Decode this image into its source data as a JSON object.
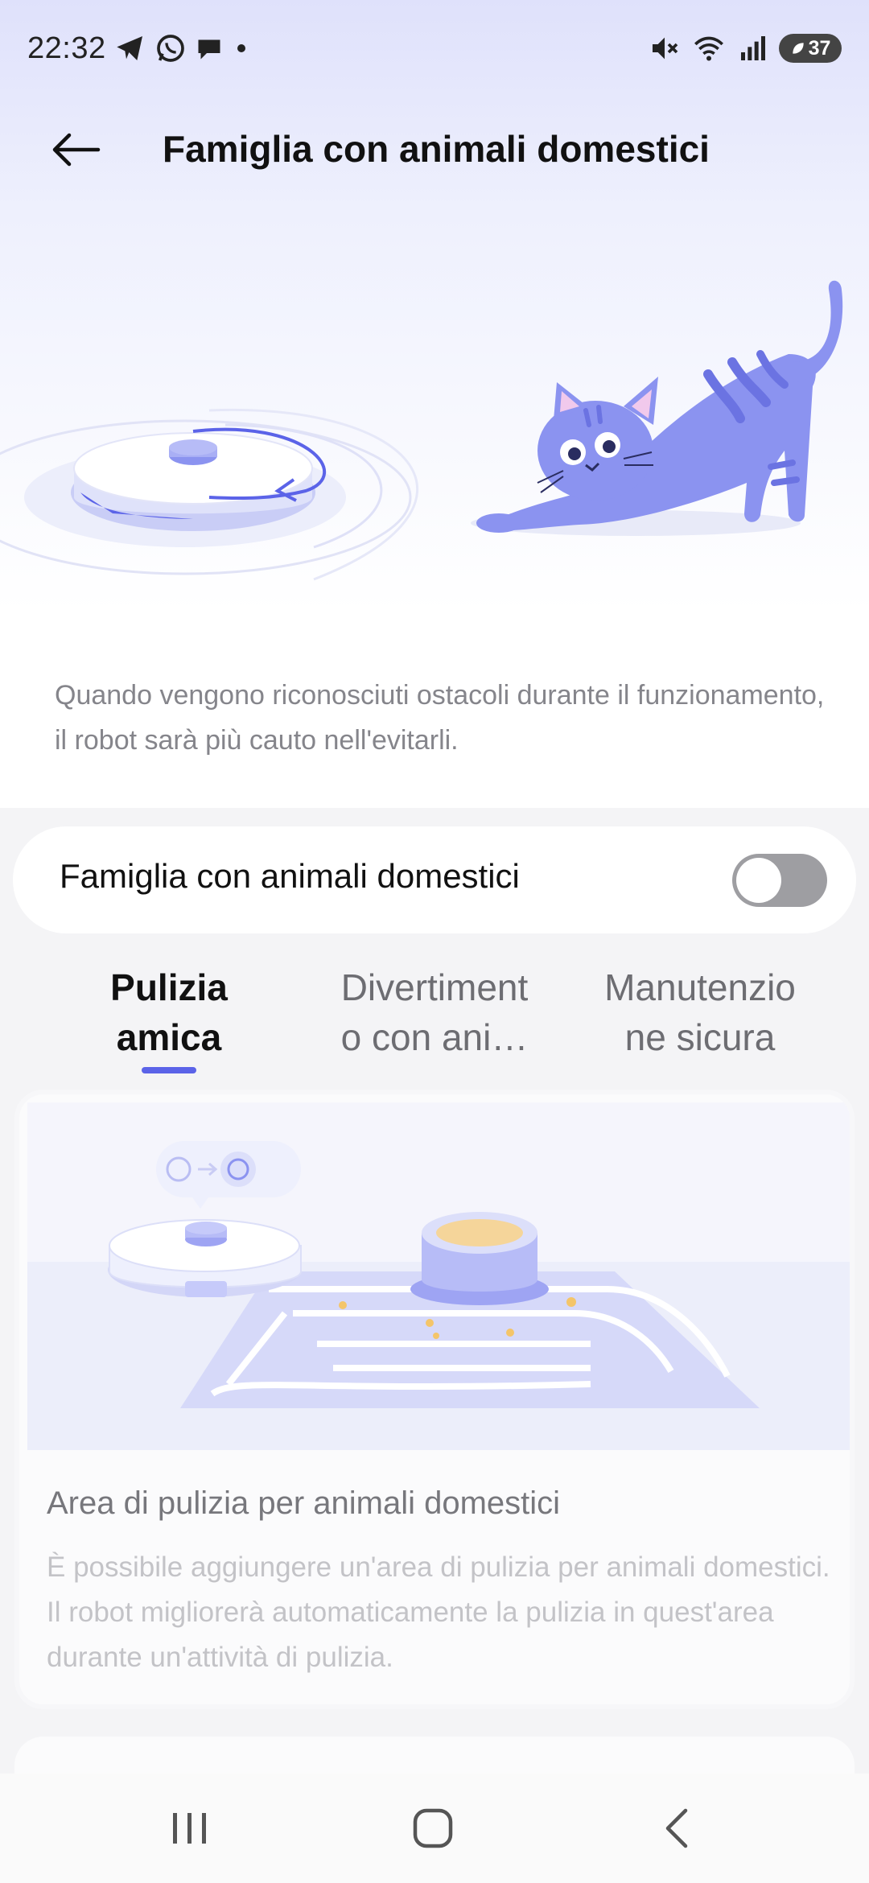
{
  "status_bar": {
    "time": "22:32",
    "battery_level": "37",
    "notification_icons": [
      "telegram-icon",
      "whatsapp-icon",
      "chat-bubble-icon",
      "dot-icon"
    ],
    "system_icons": [
      "mute-icon",
      "wifi-icon",
      "signal-icon"
    ]
  },
  "header": {
    "title": "Famiglia con animali domestici",
    "back_icon": "arrow-left-icon"
  },
  "description": "Quando vengono riconosciuti ostacoli durante il funzionamento, il robot sarà più cauto nell'evitarli.",
  "toggle_row": {
    "label": "Famiglia con animali domestici",
    "enabled": false
  },
  "tabs": [
    {
      "label_line1": "Pulizia",
      "label_line2": "amica",
      "active": true
    },
    {
      "label_line1": "Divertiment",
      "label_line2": "o con ani…",
      "active": false
    },
    {
      "label_line1": "Manutenzio",
      "label_line2": "ne sicura",
      "active": false
    }
  ],
  "feature_card": {
    "title": "Area di pulizia per animali domestici",
    "description": "È possibile aggiungere un'area di pulizia per animali domestici. Il robot migliorerà automaticamente la pulizia in quest'area durante un'attività di pulizia."
  },
  "nav_bar": {
    "buttons": [
      "recent-apps-icon",
      "home-icon",
      "back-icon"
    ]
  },
  "colors": {
    "accent": "#5b63e8",
    "cat": "#8b93f0",
    "toggle_off": "#9e9ea2"
  }
}
